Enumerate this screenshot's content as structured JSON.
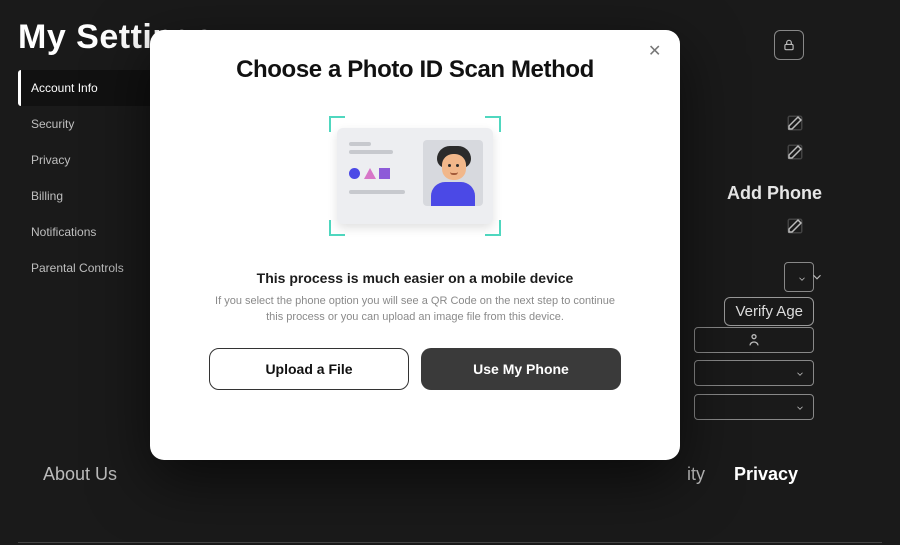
{
  "header": {
    "title": "My Settings"
  },
  "sidebar": {
    "items": [
      {
        "label": "Account Info",
        "active": true
      },
      {
        "label": "Security"
      },
      {
        "label": "Privacy"
      },
      {
        "label": "Billing"
      },
      {
        "label": "Notifications"
      },
      {
        "label": "Parental Controls"
      }
    ]
  },
  "right": {
    "add_phone": "Add Phone",
    "verify_age": "Verify Age"
  },
  "footer": {
    "about": "About Us",
    "item_partial": "ity",
    "privacy": "Privacy"
  },
  "modal": {
    "title": "Choose a Photo ID Scan Method",
    "subtitle": "This process is much easier on a mobile device",
    "help": "If you select the phone option you will see a QR Code on the next step to continue this process or you can upload an image file from this device.",
    "upload_label": "Upload a File",
    "phone_label": "Use My Phone"
  },
  "icons": {
    "lock": "lock-icon",
    "edit": "edit-icon",
    "chevron": "chevron-down-icon",
    "person": "person-icon",
    "close": "close-icon"
  }
}
